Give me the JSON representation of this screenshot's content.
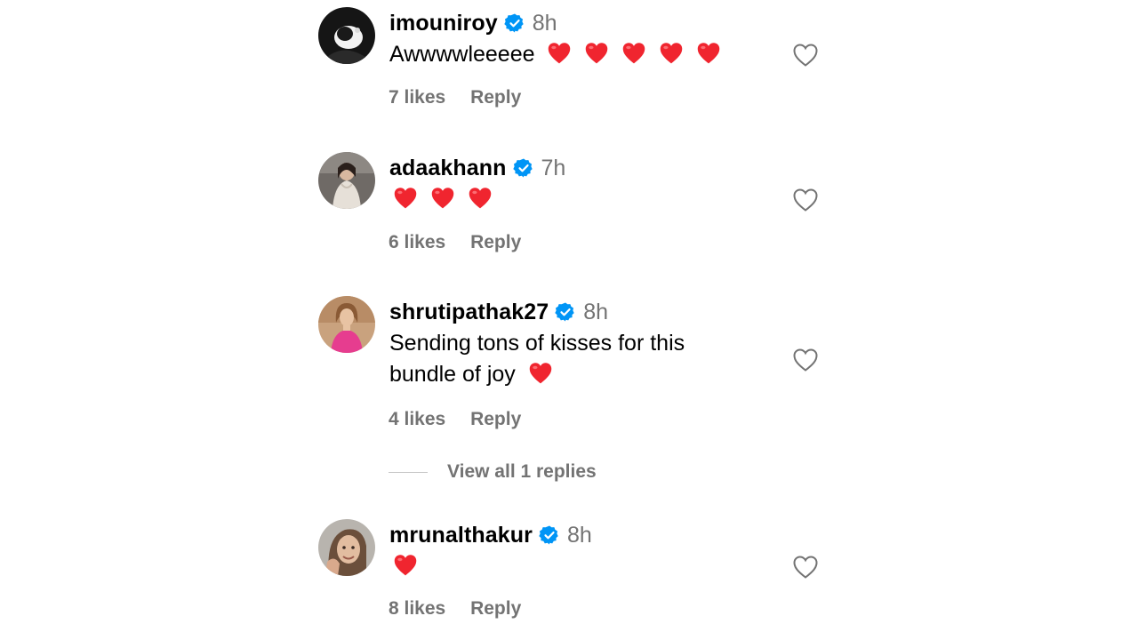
{
  "comments": [
    {
      "username": "imouniroy",
      "time": "8h",
      "text": "Awwwwleeeee",
      "heart_emojis": 5,
      "likes": "7 likes",
      "reply": "Reply",
      "avatar_icon": "avatar-dark-icon"
    },
    {
      "username": "adaakhann",
      "time": "7h",
      "text": "",
      "heart_emojis": 3,
      "likes": "6 likes",
      "reply": "Reply",
      "avatar_icon": "avatar-photo-icon"
    },
    {
      "username": "shrutipathak27",
      "time": "8h",
      "text_line1": "Sending tons of kisses for this",
      "text_line2": "bundle of joy",
      "heart_emojis": 1,
      "likes": "4 likes",
      "reply": "Reply",
      "avatar_icon": "avatar-photo-icon"
    },
    {
      "username": "mrunalthakur",
      "time": "8h",
      "text": "",
      "heart_emojis": 1,
      "likes": "8 likes",
      "reply": "Reply",
      "avatar_icon": "avatar-photo-icon"
    }
  ],
  "view_replies": "View all 1 replies",
  "colors": {
    "verified": "#0095f6",
    "heart_emoji": "#f0252f",
    "meta_gray": "#737373"
  }
}
